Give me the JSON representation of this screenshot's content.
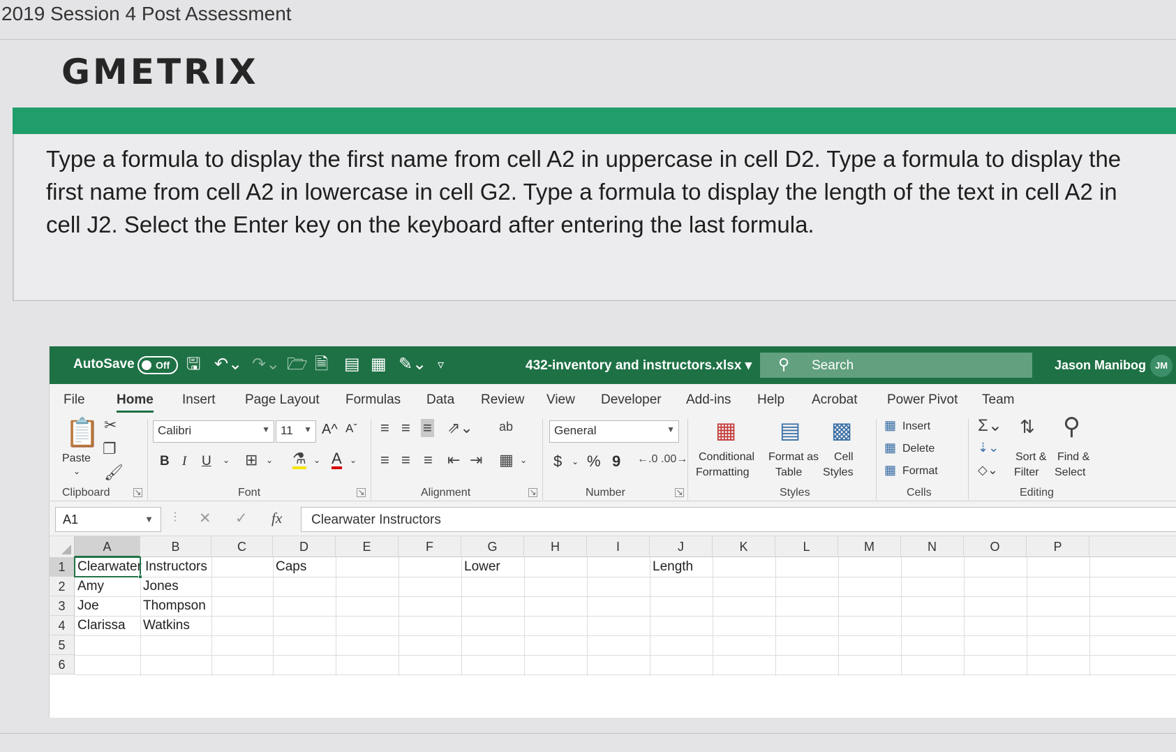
{
  "page": {
    "title": "2019 Session 4 Post Assessment",
    "logo": "GMETRIX",
    "instructions": "Type a formula to display the first name from cell A2 in uppercase in cell D2. Type a formula to display the first name from cell A2 in lowercase in cell G2. Type a formula to display the length of the text in cell A2 in cell J2. Select the Enter key on the keyboard after entering the last formula."
  },
  "excel": {
    "titlebar": {
      "autosave_label": "AutoSave",
      "autosave_state": "Off",
      "filename": "432-inventory and instructors.xlsx",
      "search_placeholder": "Search",
      "user_name": "Jason Manibog",
      "user_initials": "JM"
    },
    "tabs": [
      "File",
      "Home",
      "Insert",
      "Page Layout",
      "Formulas",
      "Data",
      "Review",
      "View",
      "Developer",
      "Add-ins",
      "Help",
      "Acrobat",
      "Power Pivot",
      "Team"
    ],
    "active_tab": "Home",
    "ribbon": {
      "clipboard": {
        "paste": "Paste",
        "group": "Clipboard"
      },
      "font": {
        "name": "Calibri",
        "size": "11",
        "bold": "B",
        "italic": "I",
        "underline": "U",
        "grow": "A^",
        "shrink": "Aˇ",
        "font_color": "A",
        "group": "Font"
      },
      "alignment": {
        "group": "Alignment"
      },
      "number": {
        "format": "General",
        "currency": "$",
        "percent": "%",
        "comma": "9",
        "group": "Number"
      },
      "styles": {
        "conditional_1": "Conditional",
        "conditional_2": "Formatting",
        "format_table_1": "Format as",
        "format_table_2": "Table",
        "cell_styles_1": "Cell",
        "cell_styles_2": "Styles",
        "group": "Styles"
      },
      "cells": {
        "insert": "Insert",
        "delete": "Delete",
        "format": "Format",
        "group": "Cells"
      },
      "editing": {
        "sort_1": "Sort &",
        "sort_2": "Filter",
        "find_1": "Find &",
        "find_2": "Select",
        "group": "Editing"
      }
    },
    "formula_bar": {
      "name_box": "A1",
      "fx": "fx",
      "content": "Clearwater Instructors"
    },
    "columns": [
      "A",
      "B",
      "C",
      "D",
      "E",
      "F",
      "G",
      "H",
      "I",
      "J",
      "K",
      "L",
      "M",
      "N",
      "O",
      "P"
    ],
    "rows": [
      "1",
      "2",
      "3",
      "4",
      "5",
      "6"
    ],
    "cells": {
      "A1": "Clearwater Instructors",
      "D1": "Caps",
      "G1": "Lower",
      "J1": "Length",
      "A2": "Amy",
      "B2": "Jones",
      "A3": "Joe",
      "B3": "Thompson",
      "A4": "Clarissa",
      "B4": "Watkins"
    },
    "active_cell": "A1"
  },
  "colors": {
    "gmetrix_green": "#1f9e6b",
    "excel_green": "#1e7145",
    "selection_green": "#217346"
  }
}
